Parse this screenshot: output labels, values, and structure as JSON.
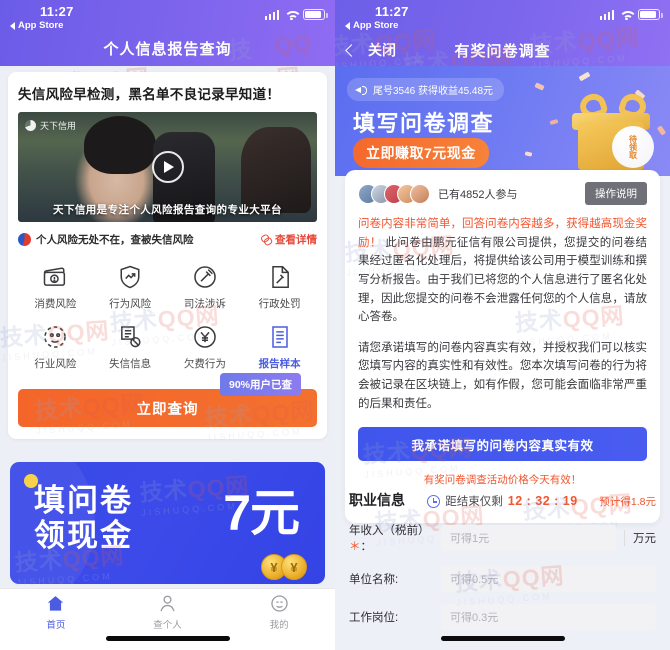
{
  "status_bar": {
    "time": "11:27",
    "back_app": "App Store",
    "icons": [
      "signal-icon",
      "wifi-icon",
      "battery-icon"
    ]
  },
  "left_screen": {
    "title": "个人信息报告查询",
    "card": {
      "headline": "失信风险早检测，黑名单不良记录早知道！",
      "video": {
        "logo": "天下信用",
        "caption": "天下信用是专注个人风险报告查询的专业大平台",
        "play": "play-icon"
      },
      "slogan": "个人风险无处不在，查被失信风险",
      "detail_link": "查看详情",
      "grid": [
        {
          "label": "消费风险",
          "icon": "wallet-warning-icon",
          "active": false
        },
        {
          "label": "行为风险",
          "icon": "shield-trend-icon",
          "active": false
        },
        {
          "label": "司法涉诉",
          "icon": "gavel-circle-icon",
          "active": false
        },
        {
          "label": "行政处罚",
          "icon": "document-gavel-icon",
          "active": false
        },
        {
          "label": "行业风险",
          "icon": "gauge-icon",
          "active": false
        },
        {
          "label": "失信信息",
          "icon": "document-ban-icon",
          "active": false
        },
        {
          "label": "欠费行为",
          "icon": "yuan-circle-icon",
          "active": false
        },
        {
          "label": "报告样本",
          "icon": "report-lines-icon",
          "active": true
        }
      ],
      "cta": "立即查询",
      "bubble": "90%用户已查"
    },
    "promo": {
      "line1": "填问卷",
      "line2": "领现金",
      "amount": "7元",
      "coin_glyph": "¥"
    },
    "tabs": [
      {
        "label": "首页",
        "icon": "home-icon",
        "active": true
      },
      {
        "label": "查个人",
        "icon": "person-icon",
        "active": false
      },
      {
        "label": "我的",
        "icon": "smiley-icon",
        "active": false
      }
    ]
  },
  "right_screen": {
    "nav": {
      "back_icon": "chevron-left-icon",
      "close": "关闭",
      "title": "有奖问卷调查"
    },
    "banner": {
      "marquee_icon": "speaker-icon",
      "marquee": "尾号3546 获得收益45.48元",
      "title": "填写问卷调查",
      "pill": "立即赚取7元现金",
      "gift_icon": "gift-box-icon",
      "gift_badge": "待领取"
    },
    "card": {
      "joined": "已有4852人参与",
      "howto_button": "操作说明",
      "para_highlight": "问卷内容非常简单，回答问卷内容越多，获得越高现金奖励！",
      "para_rest": " 此问卷由鹏元征信有限公司提供，您提交的问卷结果经过匿名化处理后，将提供给该公司用于模型训练和撰写分析报告。由于我们已将您的个人信息进行了匿名化处理，因此您提交的问卷不会泄露任何您的个人信息，请放心答卷。",
      "para2": "请您承诺填写的问卷内容真实有效，并授权我们可以核实您填写内容的真实性和有效性。您本次填写问卷的行为将会被记录在区块链上，如有作假，您可能会面临非常严重的后果和责任。",
      "promise_button": "我承诺填写的问卷内容真实有效",
      "valid_note": "有奖问卷调查活动价格今天有效！",
      "countdown_icon": "clock-icon",
      "countdown_label": "距结束仅剩",
      "countdown_value": "12 : 32 : 19"
    },
    "section": {
      "title": "职业信息",
      "reward_note": "预计得1.8元",
      "fields": [
        {
          "label": "年收入（税前）",
          "required": true,
          "placeholder": "可得1元",
          "value": "",
          "unit": "万元"
        },
        {
          "label": "单位名称:",
          "required": false,
          "placeholder": "可得0.5元",
          "value": "",
          "unit": ""
        },
        {
          "label": "工作岗位:",
          "required": false,
          "placeholder": "可得0.3元",
          "value": "",
          "unit": ""
        }
      ]
    }
  },
  "watermark": {
    "a": "技术",
    "b": "QQ网",
    "c": "JISHUQQ.COM"
  },
  "colors": {
    "purple": "#7a66ec",
    "orange": "#f4652a",
    "blue": "#3f55ec",
    "red": "#f2552f"
  }
}
